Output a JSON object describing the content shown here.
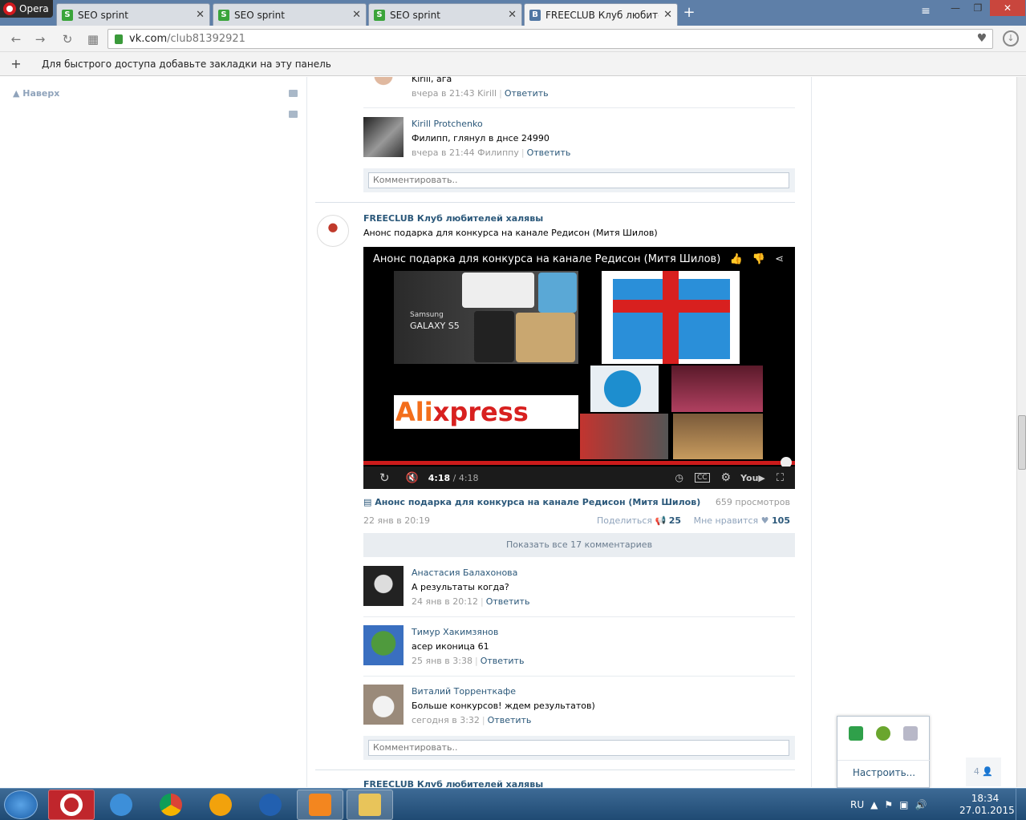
{
  "browser": {
    "app_label": "Opera",
    "tabs": [
      {
        "title": "SEO sprint",
        "fav": "S"
      },
      {
        "title": "SEO sprint",
        "fav": "S"
      },
      {
        "title": "SEO sprint",
        "fav": "S"
      },
      {
        "title": "FREECLUB Клуб любителе",
        "fav": "В"
      }
    ],
    "url_host": "vk.com",
    "url_path": "/club81392921",
    "bookmark_hint": "Для быстрого доступа добавьте закладки на эту панель"
  },
  "left": {
    "naverh": "Наверх"
  },
  "comments_top": [
    {
      "text": "Kirill, ага",
      "time": "вчера в 21:43",
      "reply_to": "Kirill",
      "reply": "Ответить"
    },
    {
      "author": "Kirill Protchenko",
      "text": "Филипп, глянул в днсе 24990",
      "time": "вчера в 21:44",
      "reply_to": "Филиппу",
      "reply": "Ответить"
    }
  ],
  "comment_placeholder": "Комментировать..",
  "post": {
    "author": "FREECLUB Клуб любителей халявы",
    "text": "Анонс подарка для конкурса на канале Редисон (Митя Шилов)",
    "video_title": "Анонс подарка для конкурса на канале Редисон (Митя Шилов)",
    "video_time_current": "4:18",
    "video_time_total": "/ 4:18",
    "video_link": "Анонс подарка для конкурса на канале Редисон (Митя Шилов)",
    "views": "659 просмотров",
    "date": "22 янв в 20:19",
    "share_label": "Поделиться",
    "share_count": "25",
    "like_label": "Мне нравится",
    "like_count": "105",
    "show_all": "Показать все 17 комментариев",
    "thumb_samsung_brand": "Samsung",
    "thumb_samsung_model": "GALAXY S5",
    "thumb_ali_1": "Ali",
    "thumb_ali_2": "xpress"
  },
  "comments": [
    {
      "author": "Анастасия Балахонова",
      "text": "А результаты когда?",
      "time": "24 янв в 20:12",
      "reply": "Ответить"
    },
    {
      "author": "Тимур Хакимзянов",
      "text": "асер иконица 61",
      "time": "25 янв в 3:38",
      "reply": "Ответить"
    },
    {
      "author": "Виталий Торренткафе",
      "text": "Больше конкурсов! ждем результатов)",
      "time": "сегодня в 3:32",
      "reply": "Ответить"
    }
  ],
  "next_post_author": "FREECLUB Клуб любителей халявы",
  "popup": {
    "settings": "Настроить..."
  },
  "online_count": "4",
  "taskbar": {
    "lang": "RU",
    "time": "18:34",
    "date": "27.01.2015"
  },
  "colors": {
    "vk_link": "#2b587a",
    "accent_red": "#cc1b1b",
    "tab_bar": "#5e7fa8"
  }
}
